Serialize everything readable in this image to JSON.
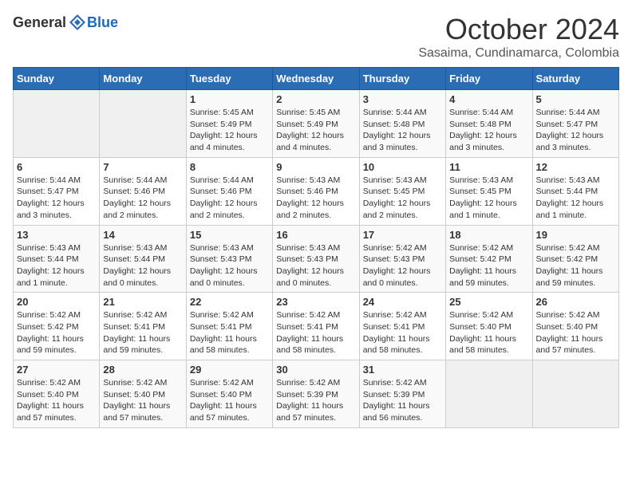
{
  "header": {
    "logo": {
      "general": "General",
      "blue": "Blue"
    },
    "title": "October 2024",
    "subtitle": "Sasaima, Cundinamarca, Colombia"
  },
  "weekdays": [
    "Sunday",
    "Monday",
    "Tuesday",
    "Wednesday",
    "Thursday",
    "Friday",
    "Saturday"
  ],
  "weeks": [
    [
      {
        "day": "",
        "info": ""
      },
      {
        "day": "",
        "info": ""
      },
      {
        "day": "1",
        "info": "Sunrise: 5:45 AM\nSunset: 5:49 PM\nDaylight: 12 hours and 4 minutes."
      },
      {
        "day": "2",
        "info": "Sunrise: 5:45 AM\nSunset: 5:49 PM\nDaylight: 12 hours and 4 minutes."
      },
      {
        "day": "3",
        "info": "Sunrise: 5:44 AM\nSunset: 5:48 PM\nDaylight: 12 hours and 3 minutes."
      },
      {
        "day": "4",
        "info": "Sunrise: 5:44 AM\nSunset: 5:48 PM\nDaylight: 12 hours and 3 minutes."
      },
      {
        "day": "5",
        "info": "Sunrise: 5:44 AM\nSunset: 5:47 PM\nDaylight: 12 hours and 3 minutes."
      }
    ],
    [
      {
        "day": "6",
        "info": "Sunrise: 5:44 AM\nSunset: 5:47 PM\nDaylight: 12 hours and 3 minutes."
      },
      {
        "day": "7",
        "info": "Sunrise: 5:44 AM\nSunset: 5:46 PM\nDaylight: 12 hours and 2 minutes."
      },
      {
        "day": "8",
        "info": "Sunrise: 5:44 AM\nSunset: 5:46 PM\nDaylight: 12 hours and 2 minutes."
      },
      {
        "day": "9",
        "info": "Sunrise: 5:43 AM\nSunset: 5:46 PM\nDaylight: 12 hours and 2 minutes."
      },
      {
        "day": "10",
        "info": "Sunrise: 5:43 AM\nSunset: 5:45 PM\nDaylight: 12 hours and 2 minutes."
      },
      {
        "day": "11",
        "info": "Sunrise: 5:43 AM\nSunset: 5:45 PM\nDaylight: 12 hours and 1 minute."
      },
      {
        "day": "12",
        "info": "Sunrise: 5:43 AM\nSunset: 5:44 PM\nDaylight: 12 hours and 1 minute."
      }
    ],
    [
      {
        "day": "13",
        "info": "Sunrise: 5:43 AM\nSunset: 5:44 PM\nDaylight: 12 hours and 1 minute."
      },
      {
        "day": "14",
        "info": "Sunrise: 5:43 AM\nSunset: 5:44 PM\nDaylight: 12 hours and 0 minutes."
      },
      {
        "day": "15",
        "info": "Sunrise: 5:43 AM\nSunset: 5:43 PM\nDaylight: 12 hours and 0 minutes."
      },
      {
        "day": "16",
        "info": "Sunrise: 5:43 AM\nSunset: 5:43 PM\nDaylight: 12 hours and 0 minutes."
      },
      {
        "day": "17",
        "info": "Sunrise: 5:42 AM\nSunset: 5:43 PM\nDaylight: 12 hours and 0 minutes."
      },
      {
        "day": "18",
        "info": "Sunrise: 5:42 AM\nSunset: 5:42 PM\nDaylight: 11 hours and 59 minutes."
      },
      {
        "day": "19",
        "info": "Sunrise: 5:42 AM\nSunset: 5:42 PM\nDaylight: 11 hours and 59 minutes."
      }
    ],
    [
      {
        "day": "20",
        "info": "Sunrise: 5:42 AM\nSunset: 5:42 PM\nDaylight: 11 hours and 59 minutes."
      },
      {
        "day": "21",
        "info": "Sunrise: 5:42 AM\nSunset: 5:41 PM\nDaylight: 11 hours and 59 minutes."
      },
      {
        "day": "22",
        "info": "Sunrise: 5:42 AM\nSunset: 5:41 PM\nDaylight: 11 hours and 58 minutes."
      },
      {
        "day": "23",
        "info": "Sunrise: 5:42 AM\nSunset: 5:41 PM\nDaylight: 11 hours and 58 minutes."
      },
      {
        "day": "24",
        "info": "Sunrise: 5:42 AM\nSunset: 5:41 PM\nDaylight: 11 hours and 58 minutes."
      },
      {
        "day": "25",
        "info": "Sunrise: 5:42 AM\nSunset: 5:40 PM\nDaylight: 11 hours and 58 minutes."
      },
      {
        "day": "26",
        "info": "Sunrise: 5:42 AM\nSunset: 5:40 PM\nDaylight: 11 hours and 57 minutes."
      }
    ],
    [
      {
        "day": "27",
        "info": "Sunrise: 5:42 AM\nSunset: 5:40 PM\nDaylight: 11 hours and 57 minutes."
      },
      {
        "day": "28",
        "info": "Sunrise: 5:42 AM\nSunset: 5:40 PM\nDaylight: 11 hours and 57 minutes."
      },
      {
        "day": "29",
        "info": "Sunrise: 5:42 AM\nSunset: 5:40 PM\nDaylight: 11 hours and 57 minutes."
      },
      {
        "day": "30",
        "info": "Sunrise: 5:42 AM\nSunset: 5:39 PM\nDaylight: 11 hours and 57 minutes."
      },
      {
        "day": "31",
        "info": "Sunrise: 5:42 AM\nSunset: 5:39 PM\nDaylight: 11 hours and 56 minutes."
      },
      {
        "day": "",
        "info": ""
      },
      {
        "day": "",
        "info": ""
      }
    ]
  ]
}
